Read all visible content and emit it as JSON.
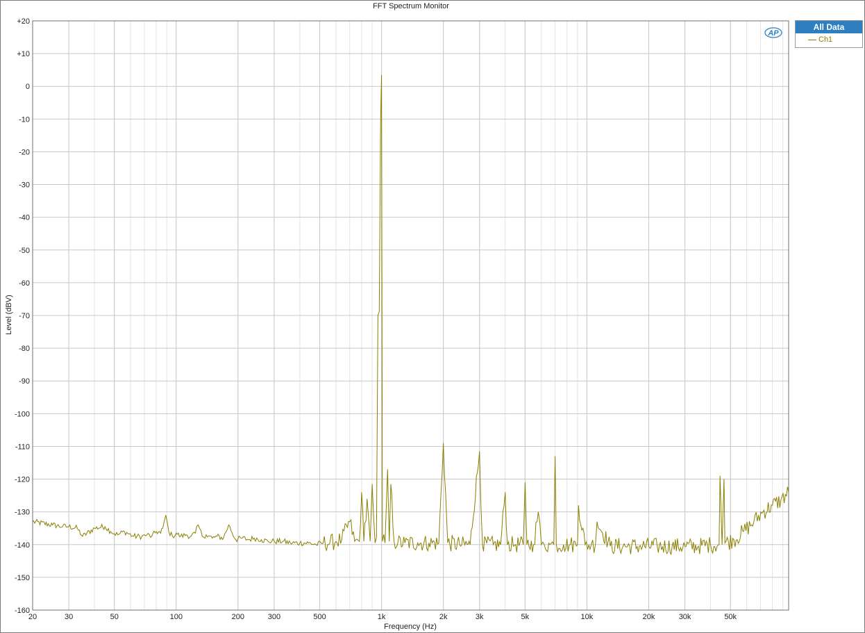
{
  "window": {
    "logo_text": "AP"
  },
  "legend": {
    "header": "All Data",
    "items": [
      {
        "label": "Ch1",
        "color": "#8a7f00"
      }
    ]
  },
  "chart_data": {
    "type": "line",
    "title": "FFT Spectrum Monitor",
    "xlabel": "Frequency (Hz)",
    "ylabel": "Level (dBV)",
    "xscale": "log",
    "xlim": [
      20,
      96000
    ],
    "ylim": [
      -160,
      20
    ],
    "grid": true,
    "legend_position": "top-right",
    "x_tick_labels": [
      {
        "value": 20,
        "label": "20"
      },
      {
        "value": 30,
        "label": "30"
      },
      {
        "value": 50,
        "label": "50"
      },
      {
        "value": 100,
        "label": "100"
      },
      {
        "value": 200,
        "label": "200"
      },
      {
        "value": 300,
        "label": "300"
      },
      {
        "value": 500,
        "label": "500"
      },
      {
        "value": 1000,
        "label": "1k"
      },
      {
        "value": 2000,
        "label": "2k"
      },
      {
        "value": 3000,
        "label": "3k"
      },
      {
        "value": 5000,
        "label": "5k"
      },
      {
        "value": 10000,
        "label": "10k"
      },
      {
        "value": 20000,
        "label": "20k"
      },
      {
        "value": 30000,
        "label": "30k"
      },
      {
        "value": 50000,
        "label": "50k"
      }
    ],
    "y_tick_labels": [
      {
        "value": 20,
        "label": "+20"
      },
      {
        "value": 10,
        "label": "+10"
      },
      {
        "value": 0,
        "label": "0"
      },
      {
        "value": -10,
        "label": "-10"
      },
      {
        "value": -20,
        "label": "-20"
      },
      {
        "value": -30,
        "label": "-30"
      },
      {
        "value": -40,
        "label": "-40"
      },
      {
        "value": -50,
        "label": "-50"
      },
      {
        "value": -60,
        "label": "-60"
      },
      {
        "value": -70,
        "label": "-70"
      },
      {
        "value": -80,
        "label": "-80"
      },
      {
        "value": -90,
        "label": "-90"
      },
      {
        "value": -100,
        "label": "-100"
      },
      {
        "value": -110,
        "label": "-110"
      },
      {
        "value": -120,
        "label": "-120"
      },
      {
        "value": -130,
        "label": "-130"
      },
      {
        "value": -140,
        "label": "-140"
      },
      {
        "value": -150,
        "label": "-150"
      },
      {
        "value": -160,
        "label": "-160"
      }
    ],
    "series": [
      {
        "name": "Ch1",
        "color": "#8a7f00",
        "x": [
          20,
          25,
          28,
          30,
          33,
          35,
          40,
          45,
          48,
          52,
          56,
          62,
          68,
          72,
          76,
          80,
          84,
          86,
          89,
          92,
          96,
          100,
          105,
          112,
          118,
          124,
          128,
          134,
          140,
          150,
          158,
          170,
          180,
          195,
          210,
          225,
          240,
          260,
          280,
          300,
          330,
          360,
          400,
          440,
          480,
          520,
          560,
          600,
          640,
          700,
          740,
          780,
          800,
          820,
          850,
          880,
          900,
          930,
          960,
          990,
          1000,
          1010,
          1040,
          1070,
          1090,
          1110,
          1150,
          1200,
          1300,
          1500,
          1700,
          1900,
          2000,
          2100,
          2400,
          2700,
          3000,
          3100,
          3500,
          3800,
          4000,
          4100,
          4500,
          4900,
          5000,
          5100,
          5500,
          5800,
          6000,
          6200,
          6600,
          6900,
          7000,
          7100,
          7700,
          8300,
          9000,
          9100,
          9800,
          10500,
          11000,
          11200,
          13000,
          15000,
          18000,
          22000,
          26000,
          30000,
          35000,
          40000,
          44000,
          44500,
          45500,
          46500,
          47000,
          52000,
          58000,
          65000,
          72000,
          80000,
          88000,
          96000
        ],
        "y": [
          -133,
          -134,
          -134.5,
          -134.5,
          -135,
          -137.5,
          -135,
          -134.5,
          -136,
          -137,
          -136,
          -137.5,
          -137.5,
          -137,
          -137.5,
          -136,
          -136.5,
          -135,
          -131,
          -136,
          -137.5,
          -136.5,
          -137.5,
          -137,
          -137.5,
          -136.5,
          -134,
          -137.5,
          -137,
          -138,
          -137.5,
          -138,
          -134,
          -138.5,
          -138,
          -138.5,
          -138,
          -138.5,
          -139,
          -139,
          -139,
          -139.5,
          -139.5,
          -139.5,
          -140,
          -139.5,
          -139.5,
          -139,
          -138.5,
          -133,
          -139,
          -139,
          -124,
          -139,
          -126,
          -139,
          -121.5,
          -139.5,
          -70,
          -10,
          3.5,
          -139,
          -139.5,
          -117,
          -139,
          -121.5,
          -139,
          -139.5,
          -139.5,
          -139.5,
          -139.5,
          -139.5,
          -109,
          -139.5,
          -140,
          -140,
          -111.5,
          -140,
          -140,
          -140,
          -124,
          -140,
          -140,
          -140,
          -121,
          -140,
          -140,
          -130,
          -140,
          -140,
          -140,
          -140,
          -113,
          -140,
          -140,
          -140,
          -140,
          -128,
          -140,
          -140,
          -140,
          -133,
          -140.5,
          -140.5,
          -140.5,
          -140.5,
          -140.5,
          -140.5,
          -140.5,
          -140,
          -140,
          -119,
          -140,
          -120,
          -139.5,
          -138.5,
          -136,
          -133,
          -130,
          -128,
          -126.5,
          -124
        ]
      }
    ]
  }
}
